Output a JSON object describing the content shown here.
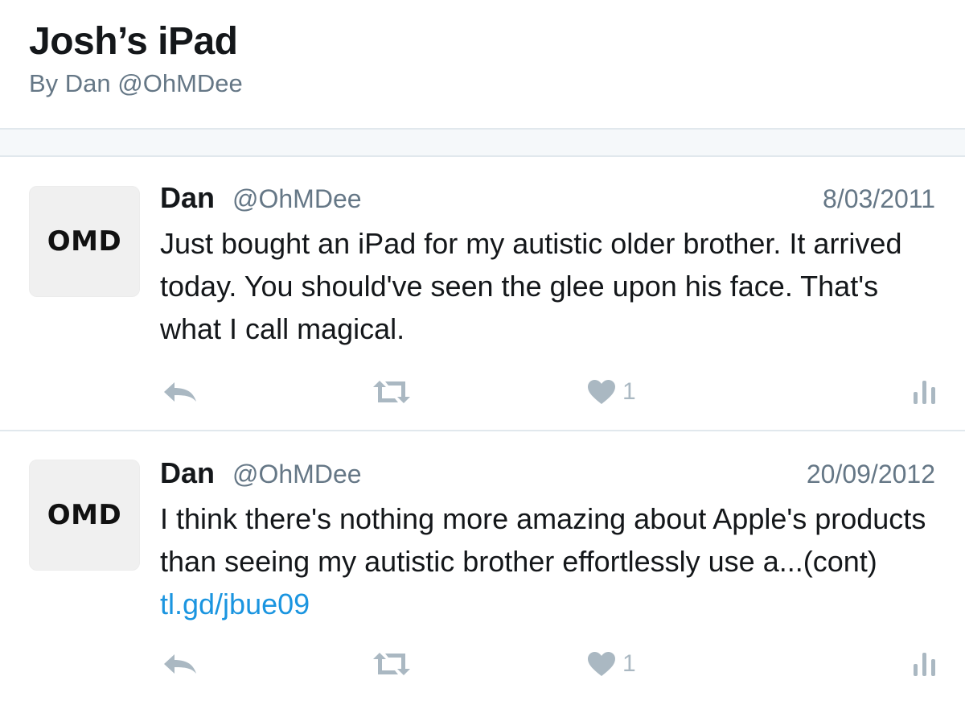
{
  "header": {
    "title": "Josh’s iPad",
    "byline": "By Dan @OhMDee"
  },
  "tweets": [
    {
      "avatar_text": "OMD",
      "name": "Dan",
      "handle": "@OhMDee",
      "date": "8/03/2011",
      "text": "Just bought an iPad for my autistic older brother. It arrived today. You should've seen the glee upon his face. That's what I call magical.",
      "link": "",
      "like_count": "1"
    },
    {
      "avatar_text": "OMD",
      "name": "Dan",
      "handle": "@OhMDee",
      "date": "20/09/2012",
      "text": "I think there's nothing more amazing about Apple's products than seeing my autistic brother effortlessly use a...(cont) ",
      "link": "tl.gd/jbue09",
      "like_count": "1"
    }
  ],
  "icons": {
    "reply": "reply-icon",
    "retweet": "retweet-icon",
    "like": "heart-icon",
    "stats": "analytics-icon"
  },
  "colors": {
    "text": "#14171a",
    "secondary": "#657786",
    "icon": "#aab8c2",
    "link": "#1b95e0",
    "border": "#e1e8ed",
    "band": "#f5f8fa"
  }
}
